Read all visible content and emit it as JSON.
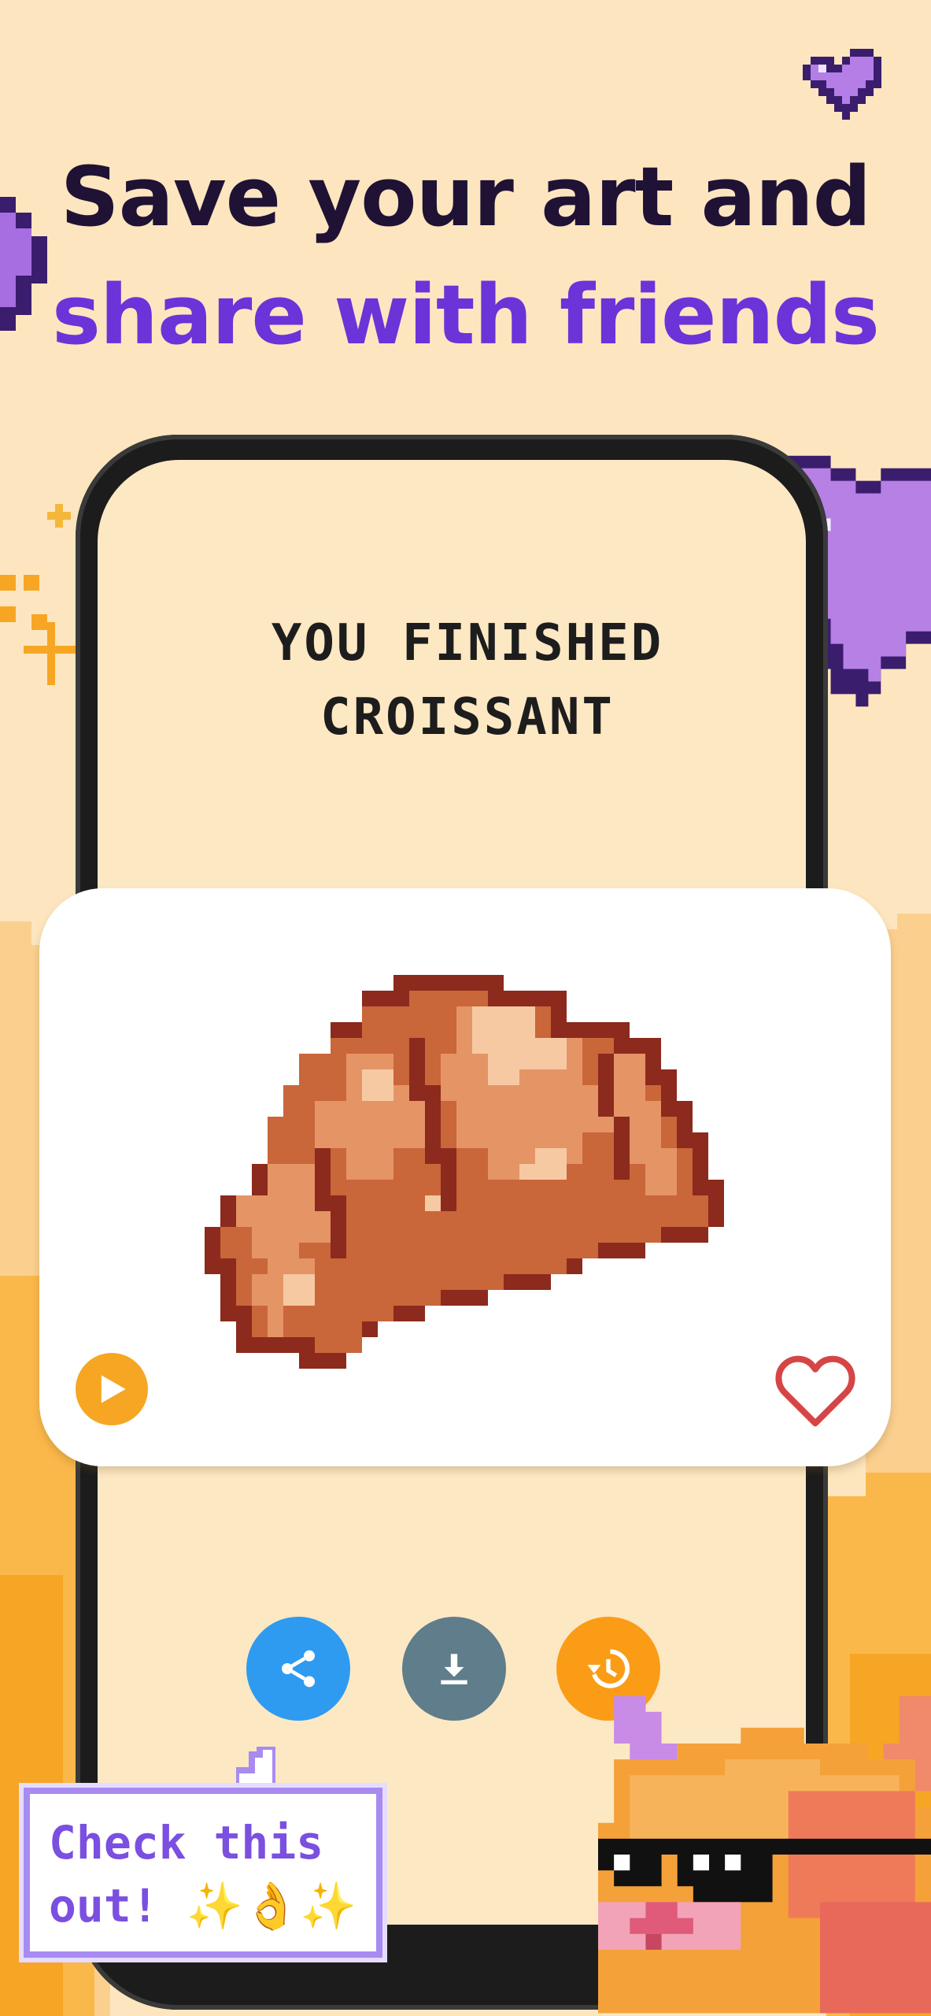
{
  "headline": {
    "line1": "Save your art and",
    "line2": "share with friends"
  },
  "result_screen": {
    "title_line1": "YOU FINISHED",
    "title_line2": "CROISSANT"
  },
  "artwork": {
    "subject": "croissant",
    "play_icon": "play-icon",
    "favorite_icon": "heart-outline-icon"
  },
  "actions": [
    {
      "name": "share",
      "icon": "share-icon",
      "color": "#2e9bf0"
    },
    {
      "name": "download",
      "icon": "download-icon",
      "color": "#5f7d8b"
    },
    {
      "name": "history",
      "icon": "history-icon",
      "color": "#fb9c16"
    }
  ],
  "bubble": {
    "line1": "Check this",
    "line2": "out! ✨👌✨"
  },
  "colors": {
    "background": "#fde6bf",
    "headline_dark": "#1f1235",
    "headline_accent": "#6a34d9",
    "heart_deco": "#b57ee0"
  }
}
